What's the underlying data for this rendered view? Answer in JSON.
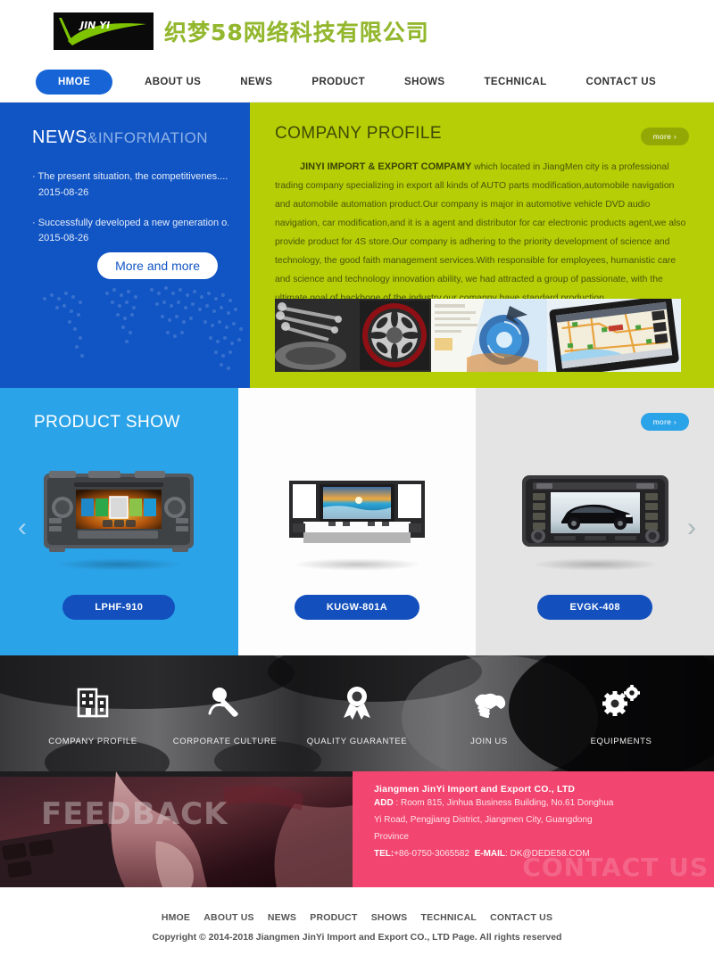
{
  "header": {
    "logo_mark_text": "JIN YI",
    "logo_icon": "green-check-swoosh-icon",
    "company_name_cn": "织梦58网络科技有限公司"
  },
  "nav": {
    "items": [
      {
        "label": "HMOE",
        "active": true
      },
      {
        "label": "ABOUT US",
        "active": false
      },
      {
        "label": "NEWS",
        "active": false
      },
      {
        "label": "PRODUCT",
        "active": false
      },
      {
        "label": "SHOWS",
        "active": false
      },
      {
        "label": "TECHNICAL",
        "active": false
      },
      {
        "label": "CONTACT US",
        "active": false
      }
    ]
  },
  "news": {
    "title_main": "NEWS",
    "title_sub": "&INFORMATION",
    "items": [
      {
        "title": "· The present situation, the competitivenes....",
        "date": "2015-08-26"
      },
      {
        "title": "· Successfully developed a new generation o....",
        "date": "2015-08-26"
      }
    ],
    "more_label": "More and more"
  },
  "profile": {
    "title": "COMPANY PROFILE",
    "more_label": "more ›",
    "lead": "JINYI IMPORT & EXPORT COMPAMY",
    "body": " which located in JiangMen city is a professional trading company specializing in export all kinds of AUTO parts modification,automobile navigation and automobile automation product.Our company is major in automotive vehicle DVD audio navigation, car modification,and it is a agent and distributor for car electronic products agent,we also provide product for 4S store.Our company is adhering to the priority development of science and technology, the good faith management services.With responsible for employees, humanistic care and science and technology innovation ability, we had attracted a group of passionate, with the ultimate goal of backbone of the industry,our comapny have standard production ...",
    "collage_alt": "auto-parts-wheel-navigation-collage"
  },
  "product_show": {
    "title": "PRODUCT SHOW",
    "more_label": "more ›",
    "prev_icon": "chevron-left-icon",
    "next_icon": "chevron-right-icon",
    "items": [
      {
        "name": "LPHF-910",
        "image_alt": "car-dvd-player-double-din"
      },
      {
        "name": "KUGW-801A",
        "image_alt": "car-dash-fascia-frame-with-screen"
      },
      {
        "name": "EVGK-408",
        "image_alt": "car-dvd-player-with-sedan-on-screen"
      }
    ]
  },
  "services": {
    "items": [
      {
        "label": "COMPANY PROFILE",
        "icon": "building-icon"
      },
      {
        "label": "CORPORATE CULTURE",
        "icon": "microphone-icon"
      },
      {
        "label": "QUALITY GUARANTEE",
        "icon": "award-ribbon-icon"
      },
      {
        "label": "JOIN US",
        "icon": "handshake-icon"
      },
      {
        "label": "EQUIPMENTS",
        "icon": "gears-icon"
      }
    ]
  },
  "feedback": {
    "word": "FEEDBACK",
    "image_alt": "finger-on-laptop-touchpad"
  },
  "contact": {
    "watermark": "CONTACT US",
    "company": "Jiangmen JinYi Import and Export CO., LTD",
    "add_label": "ADD",
    "address_line1": " : Room 815, Jinhua Business Building, No.61 Donghua",
    "address_line2": "Yi Road, Pengjiang District, Jiangmen City, Guangdong",
    "address_line3": "Province",
    "tel_label": "TEL:",
    "tel_value": "+86-0750-3065582",
    "email_label": "E-MAIL",
    "email_value": ": DK@DEDE58.COM"
  },
  "footer": {
    "nav": [
      "HMOE",
      "ABOUT US",
      "NEWS",
      "PRODUCT",
      "SHOWS",
      "TECHNICAL",
      "CONTACT US"
    ],
    "copyright": "Copyright © 2014-2018 Jiangmen JinYi Import and Export CO., LTD   Page. All rights reserved"
  },
  "colors": {
    "nav_active": "#1664d6",
    "news_blue": "#1155c4",
    "profile_green": "#b5ce06",
    "product_blue": "#2ba3e8",
    "product_button": "#1350bd",
    "contact_pink": "#f2456f",
    "logo_green": "#93b72e"
  }
}
